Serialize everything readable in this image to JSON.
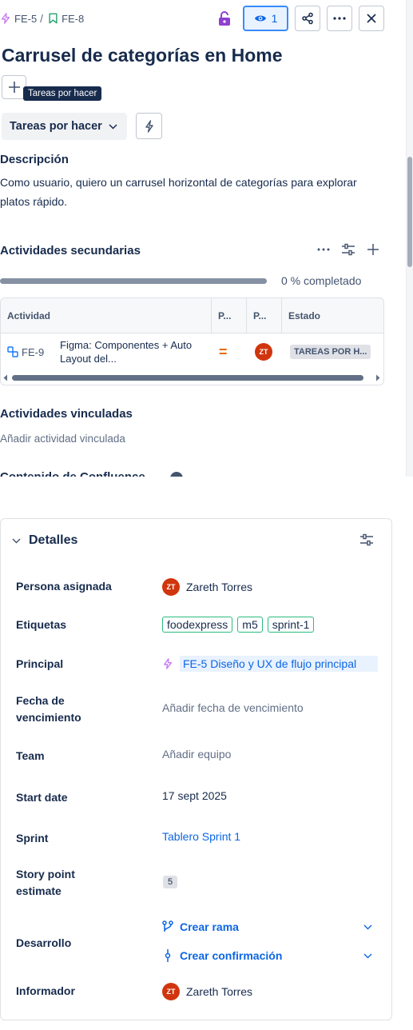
{
  "breadcrumb": {
    "parent_key": "FE-5",
    "separator": "/",
    "issue_key": "FE-8"
  },
  "header": {
    "watch_count": "1"
  },
  "issue": {
    "title": "Carrusel de categorías en Home"
  },
  "tooltip": {
    "text": "Tareas por hacer"
  },
  "status_button": {
    "label": "Tareas por hacer"
  },
  "description": {
    "heading": "Descripción",
    "text": "Como usuario, quiero un carrusel horizontal de categorías para explorar platos rápido."
  },
  "child_work": {
    "heading": "Actividades secundarias",
    "progress_percent": 0,
    "progress_label": "0 % completado",
    "columns": [
      "Actividad",
      "P...",
      "P...",
      "Estado"
    ],
    "rows": [
      {
        "key": "FE-9",
        "summary": "Figma: Componentes + Auto Layout del...",
        "priority_symbol": "=",
        "assignee_initials": "ZT",
        "status": "TAREAS POR H..."
      }
    ]
  },
  "linked_work": {
    "heading": "Actividades vinculadas",
    "add_label": "Añadir actividad vinculada"
  },
  "cut_section": {
    "text": "Contenido de Confluence"
  },
  "details": {
    "heading": "Detalles",
    "assignee": {
      "label": "Persona asignada",
      "initials": "ZT",
      "name": "Zareth Torres"
    },
    "labels": {
      "label": "Etiquetas",
      "values": [
        "foodexpress",
        "m5",
        "sprint-1"
      ]
    },
    "parent": {
      "label": "Principal",
      "value": "FE-5 Diseño y UX de flujo principal"
    },
    "due_date": {
      "label": "Fecha de vencimiento",
      "value": "Añadir fecha de vencimiento"
    },
    "team": {
      "label": "Team",
      "value": "Añadir equipo"
    },
    "start_date": {
      "label": "Start date",
      "value": "17 sept 2025"
    },
    "sprint": {
      "label": "Sprint",
      "value": "Tablero Sprint 1"
    },
    "story_points": {
      "label": "Story point estimate",
      "value": "5"
    },
    "development": {
      "label": "Desarrollo",
      "create_branch": "Crear rama",
      "create_commit": "Crear confirmación"
    },
    "reporter": {
      "label": "Informador",
      "initials": "ZT",
      "name": "Zareth Torres"
    }
  },
  "colors": {
    "accent": "#0c66e4",
    "lock": "#8f3fd1",
    "avatar": "#d0350e",
    "epic": "#c97cf4",
    "story": "#22a06b"
  }
}
